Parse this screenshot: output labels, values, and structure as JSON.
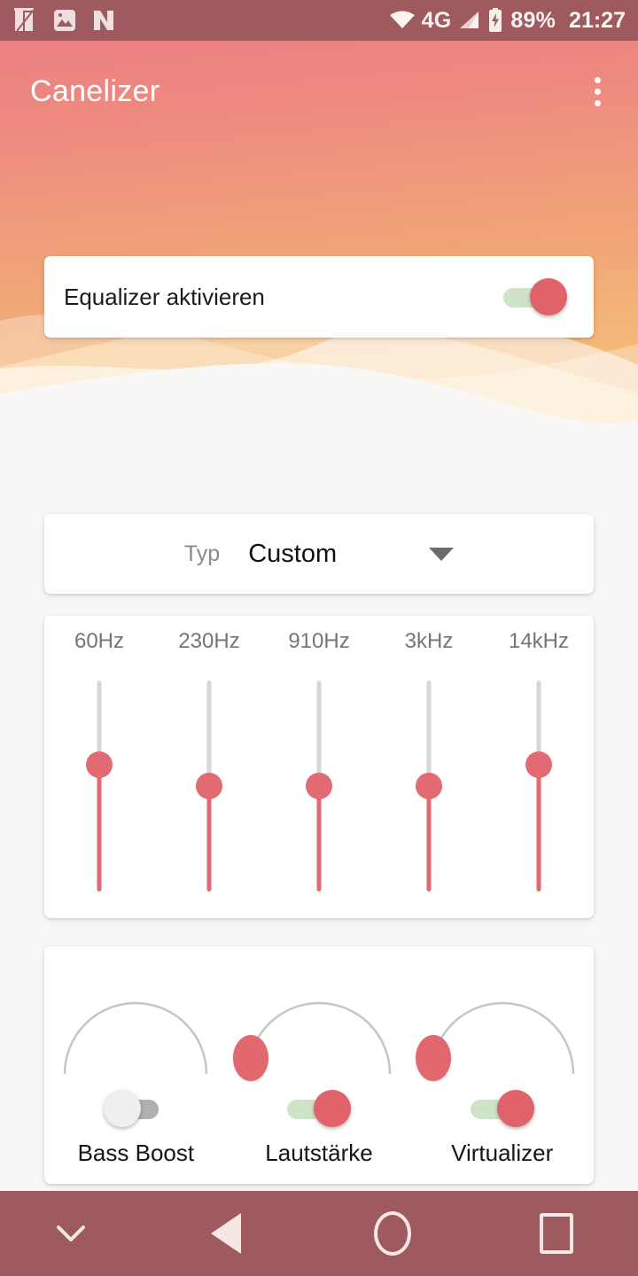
{
  "status_bar": {
    "left_icons": [
      "archive-app-icon",
      "gallery-app-icon",
      "nova-app-icon"
    ],
    "wifi_icon": "wifi-icon",
    "network_label": "4G",
    "signal_icon": "cellular-signal-icon",
    "battery_icon": "battery-charging-icon",
    "battery_percent": "89%",
    "time": "21:27",
    "background_color": "#9e5a5e"
  },
  "app_bar": {
    "title": "Canelizer",
    "overflow_menu": "overflow-menu-icon",
    "gradient_from": "#ec8082",
    "gradient_to": "#f6c87c"
  },
  "enable_card": {
    "label": "Equalizer aktivieren",
    "switch_state": "on",
    "switch_thumb_color": "#e0626b",
    "switch_track_color": "#cfe3c8"
  },
  "type_card": {
    "label": "Typ",
    "value": "Custom",
    "caret": "chevron-down-icon",
    "options": [
      "Custom"
    ]
  },
  "equalizer": {
    "bands": [
      {
        "label": "60Hz",
        "thumb_percent": 40
      },
      {
        "label": "230Hz",
        "thumb_percent": 50
      },
      {
        "label": "910Hz",
        "thumb_percent": 50
      },
      {
        "label": "3kHz",
        "thumb_percent": 50
      },
      {
        "label": "14kHz",
        "thumb_percent": 40
      }
    ],
    "track_color": "#d8d6d6",
    "fill_color": "#e06a72",
    "thumb_color": "#e16a73"
  },
  "effects": [
    {
      "name": "Bass Boost",
      "switch_state": "off",
      "knob_visible": false,
      "knob_percent": 0,
      "arc_color": "#c9c5c5"
    },
    {
      "name": "Lautstärke",
      "switch_state": "on",
      "knob_visible": true,
      "knob_percent": 0,
      "arc_color": "#c9c5c5"
    },
    {
      "name": "Virtualizer",
      "switch_state": "on",
      "knob_visible": true,
      "knob_percent": 0,
      "arc_color": "#c9c5c5"
    }
  ],
  "nav_bar": {
    "hide_keyboard": "chevron-down-icon",
    "back": "back-triangle-icon",
    "home": "home-circle-icon",
    "recents": "recents-square-icon",
    "background_color": "#9e5a5e"
  }
}
